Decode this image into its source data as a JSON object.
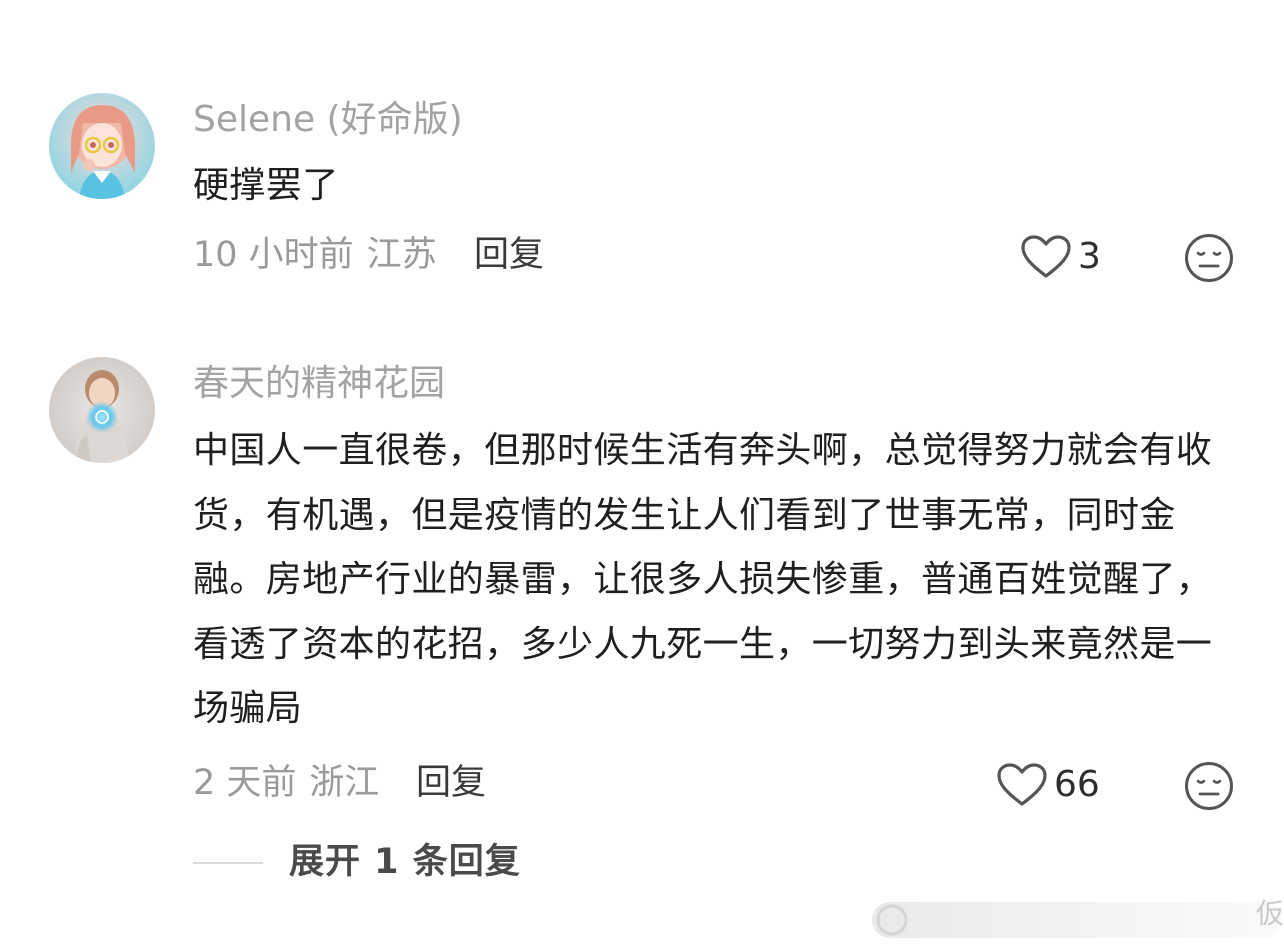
{
  "comments": [
    {
      "username": "Selene (好命版)",
      "text": "硬撑罢了",
      "time": "10 小时前",
      "location": "江苏",
      "reply_label": "回复",
      "likes": "3"
    },
    {
      "username": "春天的精神花园",
      "text": "中国人一直很卷，但那时候生活有奔头啊，总觉得努力就会有收货，有机遇，但是疫情的发生让人们看到了世事无常，同时金融。房地产行业的暴雷，让很多人损失惨重，普通百姓觉醒了，看透了资本的花招，多少人九死一生，一切努力到头来竟然是一场骗局",
      "time": "2 天前",
      "location": "浙江",
      "reply_label": "回复",
      "likes": "66"
    }
  ],
  "expand_replies_label": "展开 1 条回复",
  "watermark_text": "仮",
  "icons": {
    "like": "heart-outline-icon",
    "dislike": "neutral-face-icon"
  },
  "colors": {
    "username": "#a3a3a3",
    "meta": "#9a9a9a",
    "text": "#1f1f1f",
    "icon": "#555555"
  }
}
